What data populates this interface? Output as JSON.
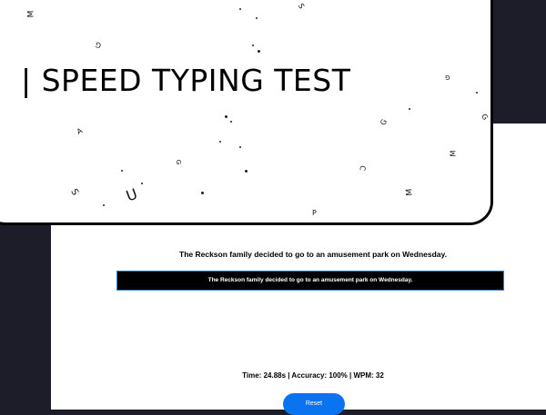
{
  "hero": {
    "title": "| SPEED TYPING TEST",
    "letters": [
      "M",
      "G",
      "S",
      "A",
      "G",
      "G",
      "G",
      "C",
      "M",
      "M",
      "S",
      "U",
      "P",
      "G"
    ]
  },
  "test": {
    "sentence": "The Reckson family decided to go to an amusement park on Wednesday.",
    "typed": "The Reckson family decided to go to an amusement park on Wednesday."
  },
  "results": {
    "stats": "Time: 24.88s | Accuracy: 100% | WPM: 32"
  },
  "controls": {
    "reset_label": "Reset"
  },
  "colors": {
    "background": "#1c1d29",
    "panel": "#ffffff",
    "accent": "#0a74f0",
    "input_border": "#2f7fd6"
  }
}
